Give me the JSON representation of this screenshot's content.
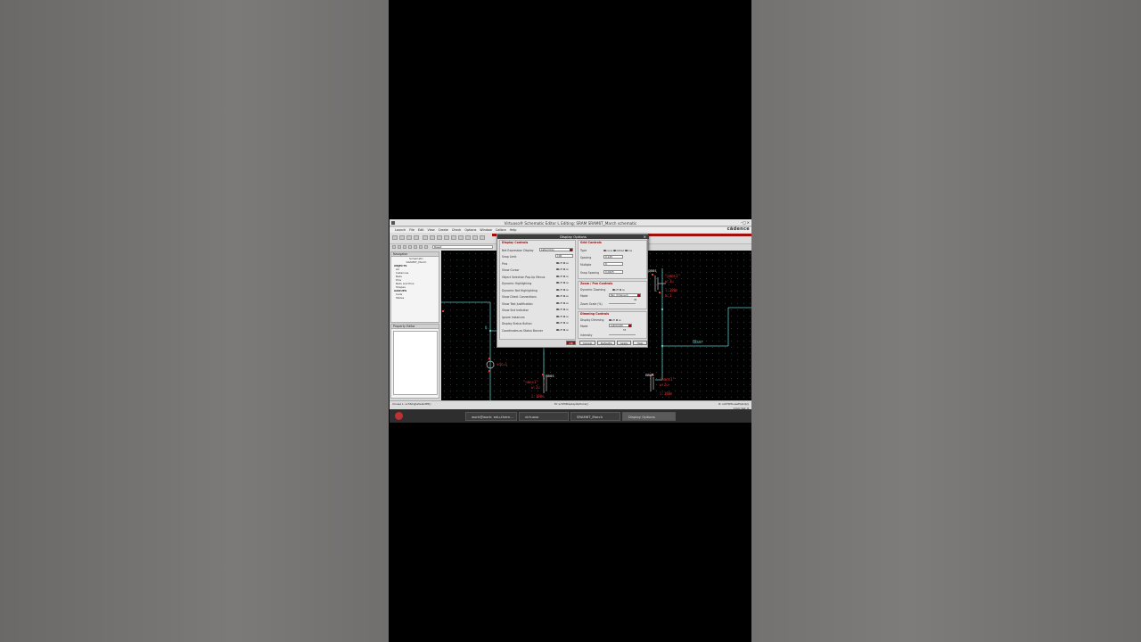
{
  "window": {
    "title": "Virtuoso® Schematic Editor L Editing: SRAM SRAM6T_March schematic",
    "brand": "cādence"
  },
  "menu": [
    "Launch",
    "File",
    "Edit",
    "View",
    "Create",
    "Check",
    "Options",
    "Window",
    "Calibre",
    "Help"
  ],
  "search": {
    "value": "Reset"
  },
  "navigator": {
    "title": "Navigator",
    "items": [
      "Schematic",
      "SRAM6T_March",
      "OBJECTS",
      "All",
      "Instances",
      "Nets",
      "Pins",
      "Nets and Pins",
      "Shapes",
      "GROUPS",
      "Cells",
      "Tables"
    ]
  },
  "property_editor": {
    "title": "Property Editor"
  },
  "dialog": {
    "title": "Display Options",
    "display_controls": {
      "header": "Display Controls",
      "rows": [
        "Net Expression Display",
        "Snap Limit",
        "Pins",
        "Show Cursor",
        "Object Selection Pop-Up Menus",
        "Dynamic Highlighting",
        "Dynamic Net Highlighting",
        "Show Direct Connections",
        "Show Text Justification",
        "Show Snd Indicator",
        "Ignore Instances",
        "Display Status Button",
        "Coordinates as Status Banner"
      ],
      "net_expr_value": "Label Only",
      "snap_limit": "100",
      "off_label": "off",
      "on_label": "on"
    },
    "grid_controls": {
      "header": "Grid Controls",
      "type_label": "Type",
      "type_options": [
        "none",
        "dotted",
        "line"
      ],
      "spacing_label": "Spacing",
      "spacing_value": "0.125",
      "multiple_label": "Multiple",
      "multiple_value": "8",
      "snap_spacing_label": "Snap Spacing",
      "snap_spacing_value": "0.0625"
    },
    "zoom_pan": {
      "header": "Zoom / Pan Controls",
      "dynamic_zooming": "Dynamic Zooming",
      "mode_label": "Mode",
      "mode_value": "Pan (Chained)",
      "zoom_scale_label": "Zoom Scale (%)",
      "zoom_scale_value": "40"
    },
    "dimming": {
      "header": "Dimming Controls",
      "display_dimming": "Display Dimming",
      "mode_label": "Mode",
      "mode_value": "automatic",
      "intensity_label": "Intensity",
      "intensity_value": "55"
    },
    "buttons": [
      "OK",
      "Cancel",
      "Defaults",
      "Apply",
      "Help"
    ]
  },
  "schematic": {
    "labels_red": [
      "nmos",
      "\"nmos1\"",
      "w:2u",
      "l:180n",
      "m:1",
      "pmos",
      "\"pmos1\"",
      "w:3u",
      "l:180n",
      "nmos",
      "\"nmos1\"",
      "w:2u",
      "l:180n",
      "m:1",
      "vdc=1"
    ],
    "net_label": "Qbar",
    "pin_label": "Q"
  },
  "status": {
    "left": "mouse L: schSingleSelectPt()",
    "mid": "M: schHiDisplayOptions()",
    "right": "R: schHiMousePopUp()",
    "cmd": "Cmd: Sel: 0"
  },
  "taskbar": [
    "work@work: edu-them...",
    "virtuoso",
    "SRAM6T_March",
    "Display Options"
  ]
}
